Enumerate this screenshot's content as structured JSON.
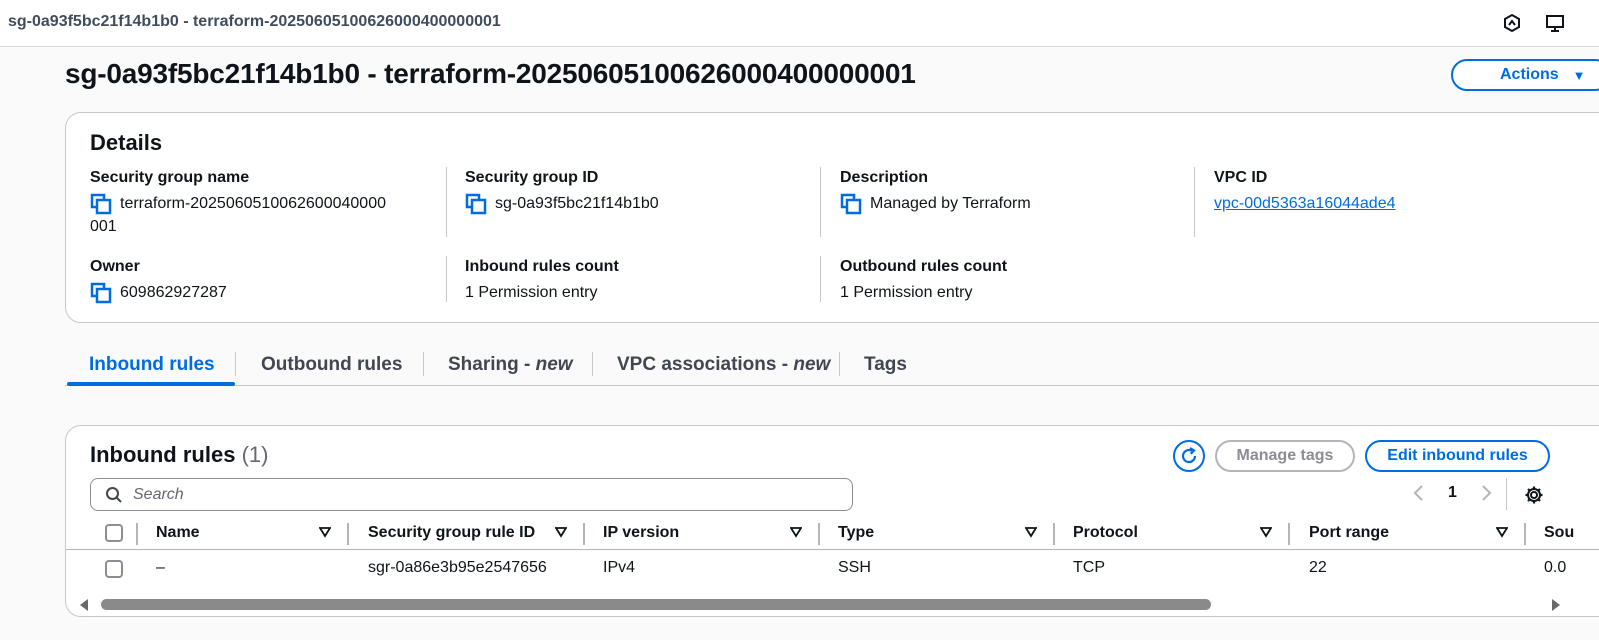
{
  "window": {
    "tab_title": "sg-0a93f5bc21f14b1b0 - terraform-20250605100626000400000001"
  },
  "header": {
    "title": "sg-0a93f5bc21f14b1b0 - terraform-20250605100626000400000001",
    "actions_label": "Actions"
  },
  "details": {
    "heading": "Details",
    "security_group_name": {
      "label": "Security group name",
      "value_line1": "terraform-2025060510062600040000",
      "value_line2": "001"
    },
    "security_group_id": {
      "label": "Security group ID",
      "value": "sg-0a93f5bc21f14b1b0"
    },
    "description": {
      "label": "Description",
      "value": "Managed by Terraform"
    },
    "vpc_id": {
      "label": "VPC ID",
      "value": "vpc-00d5363a16044ade4"
    },
    "owner": {
      "label": "Owner",
      "value": "609862927287"
    },
    "inbound_count": {
      "label": "Inbound rules count",
      "value": "1 Permission entry"
    },
    "outbound_count": {
      "label": "Outbound rules count",
      "value": "1 Permission entry"
    }
  },
  "tabs": [
    {
      "label": "Inbound rules",
      "suffix": ""
    },
    {
      "label": "Outbound rules",
      "suffix": ""
    },
    {
      "label": "Sharing - ",
      "suffix": "new"
    },
    {
      "label": "VPC associations - ",
      "suffix": "new"
    },
    {
      "label": "Tags",
      "suffix": ""
    }
  ],
  "rules": {
    "title": "Inbound rules",
    "count": "(1)",
    "manage_tags_label": "Manage tags",
    "edit_label": "Edit inbound rules",
    "search_placeholder": "Search",
    "page_number": "1",
    "columns": [
      "Name",
      "Security group rule ID",
      "IP version",
      "Type",
      "Protocol",
      "Port range",
      "Sou"
    ],
    "rows": [
      {
        "name": "–",
        "rule_id": "sgr-0a86e3b95e2547656",
        "ip_version": "IPv4",
        "type": "SSH",
        "protocol": "TCP",
        "port_range": "22",
        "source": "0.0"
      }
    ]
  },
  "colors": {
    "accent": "#006ce0",
    "text": "#0f141a",
    "border": "#c6c6cd"
  }
}
